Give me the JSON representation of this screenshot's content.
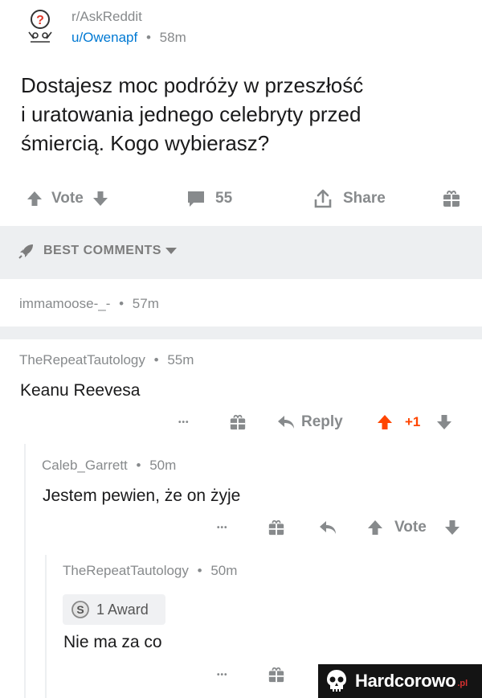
{
  "post": {
    "subreddit": "r/AskReddit",
    "user": "u/Owenapf",
    "age": "58m",
    "title_lines": [
      "Dostajesz moc podróży w przeszłość",
      "i uratowania jednego celebryty przed",
      "śmiercią. Kogo wybierasz?"
    ]
  },
  "actions": {
    "vote_label": "Vote",
    "comment_count": "55",
    "share_label": "Share"
  },
  "sort": {
    "label": "BEST COMMENTS"
  },
  "comments": [
    {
      "user": "immamoose-_-",
      "age": "57m"
    },
    {
      "user": "TheRepeatTautology",
      "age": "55m",
      "body": "Keanu Reevesa",
      "actions": {
        "more": "•••",
        "reply": "Reply",
        "score": "+1"
      }
    },
    {
      "user": "Caleb_Garrett",
      "age": "50m",
      "body": "Jestem pewien, że on żyje",
      "actions": {
        "more": "•••",
        "vote": "Vote"
      }
    },
    {
      "user": "TheRepeatTautology",
      "age": "50m",
      "award": "1 Award",
      "body": "Nie ma za co",
      "actions": {
        "more": "•••"
      }
    }
  ],
  "separator": "•",
  "watermark": {
    "text": "Hardcorowo",
    "suffix": ".pl"
  },
  "colors": {
    "upvote": "#ff4500",
    "link": "#0079d3",
    "muted": "#878a8c",
    "band": "#edeff1"
  }
}
